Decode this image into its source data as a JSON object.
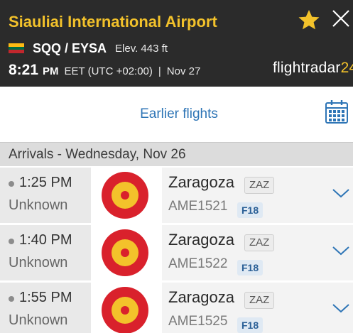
{
  "header": {
    "airport_name": "Siauliai International Airport",
    "codes": "SQQ / EYSA",
    "elevation": "Elev. 443 ft",
    "local_time": "8:21",
    "time_ampm": "PM",
    "timezone": "EET (UTC +02:00)",
    "separator": "|",
    "date": "Nov 27",
    "logo_text": "flightradar",
    "logo_number": "24",
    "flag": "lithuania-flag",
    "star_icon": "star-icon",
    "close_icon": "close-icon",
    "colors": {
      "background": "#2b2b2b",
      "title": "#f3c22b"
    }
  },
  "earlier": {
    "label": "Earlier flights",
    "calendar_icon": "calendar-icon",
    "color": "#2e75b6"
  },
  "section": {
    "title": "Arrivals - Wednesday, Nov 26"
  },
  "flights": [
    {
      "time": "1:25 PM",
      "status": "Unknown",
      "city": "Zaragoza",
      "code": "ZAZ",
      "flight": "AME1521",
      "aircraft": "F18",
      "airline_logo": "spanish-air-force-roundel"
    },
    {
      "time": "1:40 PM",
      "status": "Unknown",
      "city": "Zaragoza",
      "code": "ZAZ",
      "flight": "AME1522",
      "aircraft": "F18",
      "airline_logo": "spanish-air-force-roundel"
    },
    {
      "time": "1:55 PM",
      "status": "Unknown",
      "city": "Zaragoza",
      "code": "ZAZ",
      "flight": "AME1525",
      "aircraft": "F18",
      "airline_logo": "spanish-air-force-roundel"
    }
  ]
}
